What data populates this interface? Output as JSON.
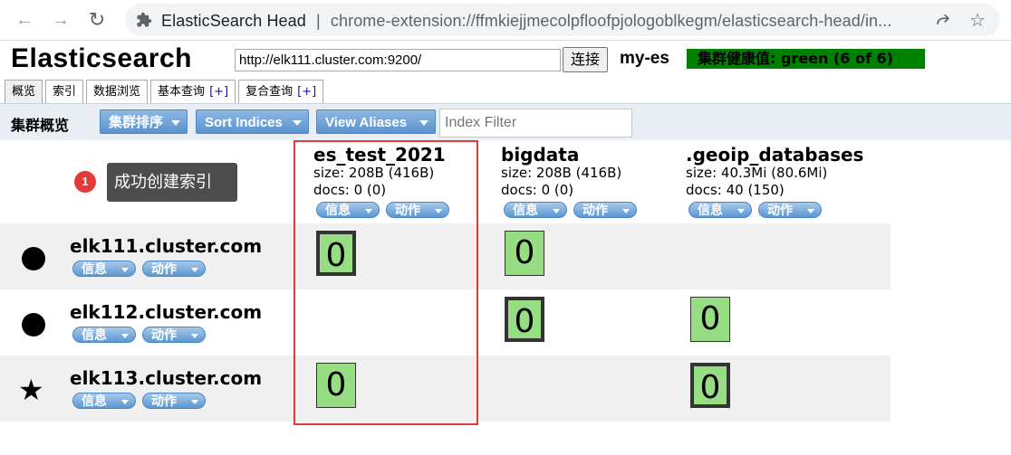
{
  "browser": {
    "site_name": "ElasticSearch Head",
    "separator": "|",
    "url": "chrome-extension://ffmkiejjmecolpfloofpjologoblkegm/elasticsearch-head/in..."
  },
  "header": {
    "title": "Elasticsearch",
    "connect_url": "http://elk111.cluster.com:9200/",
    "connect_label": "连接",
    "cluster_name": "my-es",
    "health_text": "集群健康值: green (6 of 6)",
    "health_color": "#008000"
  },
  "tabs": [
    {
      "label": "概览",
      "active": true
    },
    {
      "label": "索引"
    },
    {
      "label": "数据浏览"
    },
    {
      "label": "基本查询",
      "plus": "[+]"
    },
    {
      "label": "复合查询",
      "plus": "[+]"
    }
  ],
  "toolbar": {
    "title": "集群概览",
    "sort_cluster": "集群排序",
    "sort_indices": "Sort Indices",
    "view_aliases": "View Aliases",
    "filter_placeholder": "Index Filter"
  },
  "tooltip": {
    "badge": "1",
    "text": "成功创建索引"
  },
  "actions": {
    "info": "信息",
    "action": "动作"
  },
  "indices": [
    {
      "name": "es_test_2021",
      "size": "size: 208B (416B)",
      "docs": "docs: 0 (0)"
    },
    {
      "name": "bigdata",
      "size": "size: 208B (416B)",
      "docs": "docs: 0 (0)"
    },
    {
      "name": ".geoip_databases",
      "size": "size: 40.3Mi (80.6Mi)",
      "docs": "docs: 40 (150)"
    }
  ],
  "nodes": [
    {
      "name": "elk111.cluster.com",
      "icon": "dot-icon"
    },
    {
      "name": "elk112.cluster.com",
      "icon": "dot-icon"
    },
    {
      "name": "elk113.cluster.com",
      "icon": "master-star-icon"
    }
  ],
  "shards": {
    "s1": "0",
    "s2": "0",
    "s3": "0",
    "s4": "0",
    "s5": "0",
    "s6": "0"
  },
  "colors": {
    "shard_green": "#97dd84",
    "highlight_red": "#e53935"
  }
}
